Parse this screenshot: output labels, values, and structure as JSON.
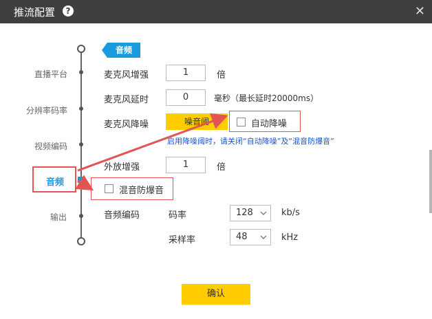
{
  "window": {
    "title": "推流配置"
  },
  "nav": {
    "items": [
      {
        "label": "直播平台"
      },
      {
        "label": "分辨率码率"
      },
      {
        "label": "视频编码"
      },
      {
        "label": "音频"
      },
      {
        "label": "输出"
      }
    ],
    "active_index": 3
  },
  "section": {
    "tag": "音频"
  },
  "mic_boost": {
    "label": "麦克风增强",
    "value": "1",
    "unit": "倍"
  },
  "mic_delay": {
    "label": "麦克风延时",
    "value": "0",
    "unit": "毫秒（最长延时20000ms）"
  },
  "mic_noise": {
    "label": "麦克风降噪",
    "button_label": "噪音阈",
    "auto_noise_label": "自动降噪",
    "auto_noise_checked": false,
    "hint": "启用降噪阈时，请关闭“自动降噪”及“混音防爆音”"
  },
  "speaker_boost": {
    "label": "外放增强",
    "value": "1",
    "unit": "倍"
  },
  "mix_anti_pop": {
    "label": "混音防爆音",
    "checked": false
  },
  "audio_encoding": {
    "label": "音频编码",
    "bitrate": {
      "label": "码率",
      "value": "128",
      "unit": "kb/s"
    },
    "sample_rate": {
      "label": "采样率",
      "value": "48",
      "unit": "kHz"
    }
  },
  "confirm": {
    "label": "确认"
  },
  "colors": {
    "accent": "#1a9be0",
    "button": "#ffcc00",
    "annotation": "#e25555",
    "hint": "#1a4fd4",
    "titlebar": "#3f3f3f"
  }
}
